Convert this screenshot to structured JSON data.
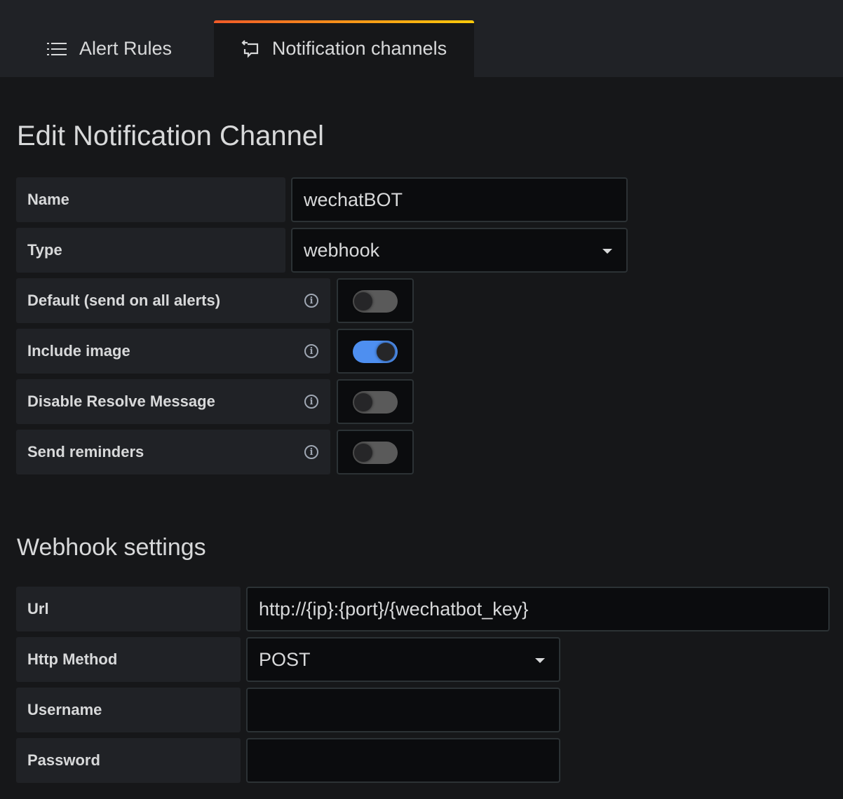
{
  "tabs": [
    {
      "label": "Alert Rules",
      "icon": "list-icon",
      "active": false
    },
    {
      "label": "Notification channels",
      "icon": "comment-alt-share-icon",
      "active": true
    }
  ],
  "title": "Edit Notification Channel",
  "fields": {
    "name": {
      "label": "Name",
      "value": "wechatBOT"
    },
    "type": {
      "label": "Type",
      "value": "webhook"
    },
    "default": {
      "label": "Default (send on all alerts)",
      "on": false
    },
    "include_image": {
      "label": "Include image",
      "on": true
    },
    "disable_resolve": {
      "label": "Disable Resolve Message",
      "on": false
    },
    "send_reminders": {
      "label": "Send reminders",
      "on": false
    }
  },
  "webhook": {
    "title": "Webhook settings",
    "url": {
      "label": "Url",
      "value": "http://{ip}:{port}/{wechatbot_key}"
    },
    "method": {
      "label": "Http Method",
      "value": "POST"
    },
    "username": {
      "label": "Username",
      "value": ""
    },
    "password": {
      "label": "Password",
      "value": ""
    }
  },
  "colors": {
    "accent": "#4e8ff0",
    "tab_gradient": [
      "#f05a28",
      "#fbca0a"
    ]
  }
}
